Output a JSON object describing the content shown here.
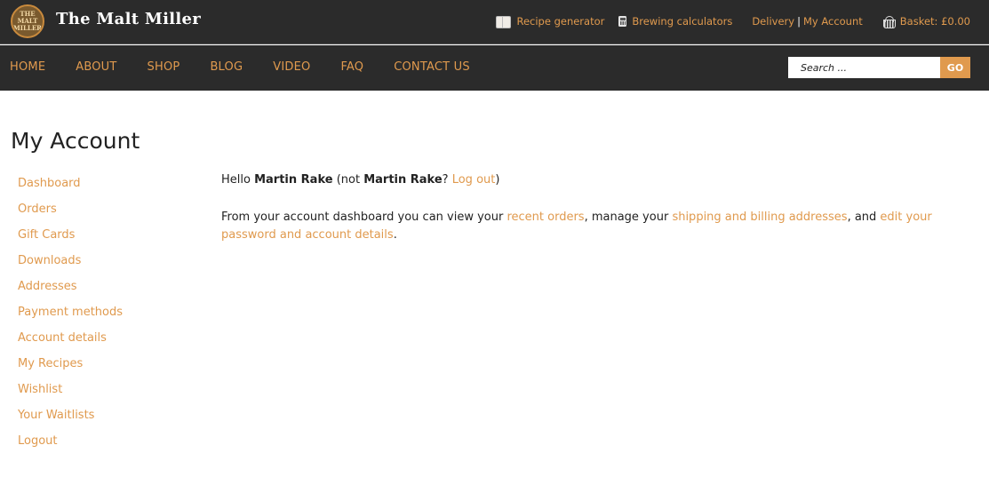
{
  "header": {
    "logo_text": "THE MALT MILLER",
    "brand": "The Malt Miller",
    "links": {
      "recipe_generator": "Recipe generator",
      "brewing_calculators": "Brewing calculators",
      "delivery": "Delivery",
      "separator": "|",
      "my_account": "My Account",
      "basket": "Basket: £0.00"
    }
  },
  "nav": {
    "items": [
      "HOME",
      "ABOUT",
      "SHOP",
      "BLOG",
      "VIDEO",
      "FAQ",
      "CONTACT US"
    ],
    "search_placeholder": "Search ...",
    "go_label": "GO"
  },
  "page": {
    "title": "My Account"
  },
  "sidebar": {
    "items": [
      "Dashboard",
      "Orders",
      "Gift Cards",
      "Downloads",
      "Addresses",
      "Payment methods",
      "Account details",
      "My Recipes",
      "Wishlist",
      "Your Waitlists",
      "Logout"
    ]
  },
  "content": {
    "hello": "Hello ",
    "user_name": "Martin Rake",
    "not_prefix": " (not ",
    "user_name_again": "Martin Rake",
    "question": "? ",
    "logout_link": "Log out",
    "close_paren": ")",
    "dash_text_1": "From your account dashboard you can view your ",
    "recent_orders_link": "recent orders",
    "dash_text_2": ", manage your ",
    "addresses_link": "shipping and billing addresses",
    "dash_text_3": ", and ",
    "account_details_link": "edit your password and account details",
    "dash_text_4": "."
  },
  "colors": {
    "accent": "#e09a4e",
    "header_bg": "#2b2b2b",
    "text": "#222222"
  }
}
